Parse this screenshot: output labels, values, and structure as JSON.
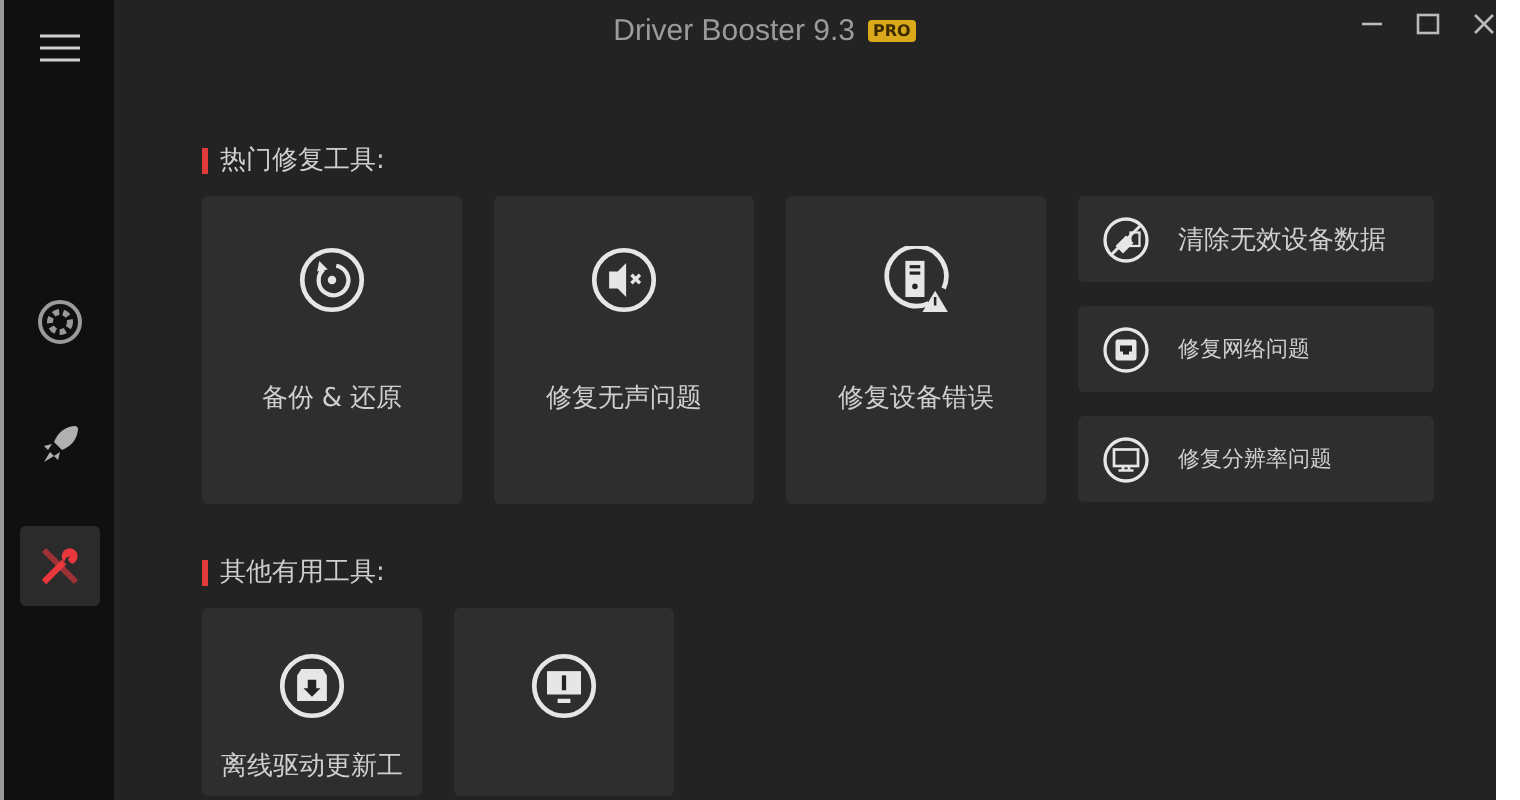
{
  "window": {
    "title": "Driver Booster 9.3",
    "badge": "PRO"
  },
  "sidebar": {
    "items": [
      {
        "selected": false
      },
      {
        "selected": false
      },
      {
        "selected": true
      }
    ]
  },
  "sections": [
    {
      "heading": "热门修复工具:",
      "large_tiles": [
        {
          "label": "备份 & 还原"
        },
        {
          "label": "修复无声问题"
        },
        {
          "label": "修复设备错误"
        }
      ],
      "small_tiles": [
        {
          "label": "清除无效设备数据"
        },
        {
          "label": "修复网络问题"
        },
        {
          "label": "修复分辨率问题"
        }
      ]
    },
    {
      "heading": "其他有用工具:",
      "large_tiles": [
        {
          "kind": "labeled",
          "label": "离线驱动更新工"
        },
        {
          "kind": "icon_only"
        }
      ]
    }
  ]
}
